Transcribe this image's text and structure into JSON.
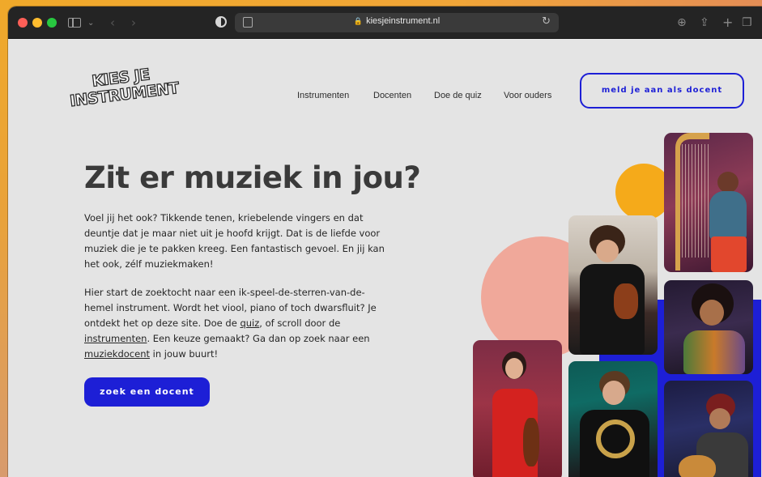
{
  "browser": {
    "url": "kiesjeinstrument.nl"
  },
  "site": {
    "logo": {
      "line1": "KIES JE",
      "line2": "INSTRUMENT"
    },
    "nav": {
      "items": [
        {
          "label": "Instrumenten"
        },
        {
          "label": "Docenten"
        },
        {
          "label": "Doe de quiz"
        },
        {
          "label": "Voor ouders"
        }
      ],
      "cta_label": "meld je aan als docent"
    },
    "hero": {
      "headline": "Zit er muziek in jou?",
      "paragraph1": "Voel jij het ook? Tikkende tenen, kriebelende vingers en dat deuntje dat je maar niet uit je hoofd krijgt. Dat is de liefde voor muziek die je te pakken kreeg. Een fantastisch gevoel. En jij kan het ook, zélf muziekmaken!",
      "paragraph2": {
        "p1": "Hier start de zoektocht naar een ik-speel-de-sterren-van-de-hemel instrument. Wordt het viool, piano of toch dwarsfluit? Je ontdekt het op deze site. Doe de ",
        "link_quiz": "quiz",
        "p2": ", of scroll door de ",
        "link_instrumenten": "instrumenten",
        "p3": ". Een keuze gemaakt? Ga dan op zoek naar een ",
        "link_docent": "muziekdocent",
        "p4": " in jouw buurt!"
      },
      "cta_label": "zoek een docent"
    }
  },
  "colors": {
    "primary_blue": "#1d1fd6",
    "accent_pink": "#f0a89a",
    "accent_yellow": "#f5aa1a",
    "page_bg": "#e4e4e4"
  }
}
